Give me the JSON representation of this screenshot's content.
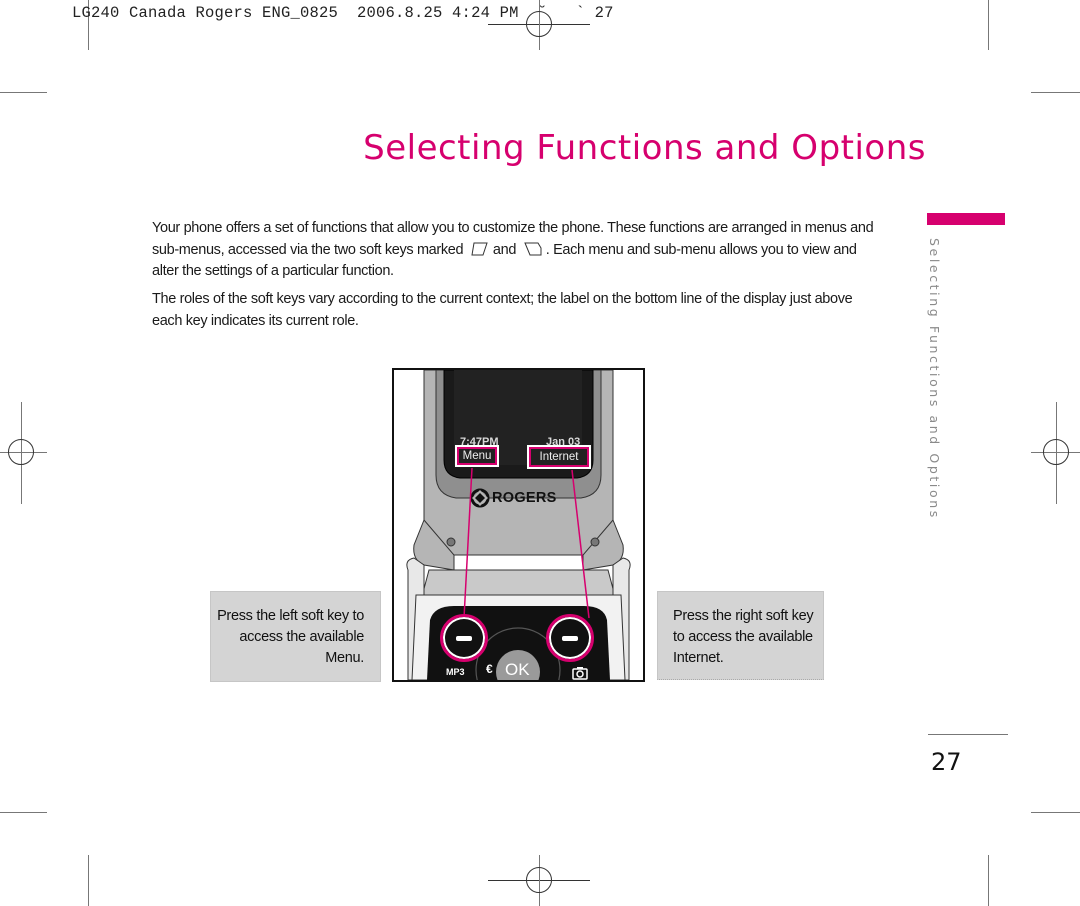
{
  "print_slug": {
    "text": "LG240 Canada Rogers ENG_0825  2006.8.25 4:24 PM  ˘   ` 27"
  },
  "page": {
    "title": "Selecting Functions and Options",
    "accent_color": "#d6006e",
    "section_tab_label": "Selecting Functions and Options",
    "page_number": "27"
  },
  "body": {
    "paragraph_1": {
      "before_keys": "Your phone offers a set of functions that allow you to customize the phone. These functions are arranged in menus and sub-menus, accessed via the two soft keys marked",
      "between_keys": "and",
      "after_keys": ". Each menu and sub-menu allows you to view and alter the settings of a particular function.",
      "left_key_icon": "left-softkey-icon",
      "right_key_icon": "right-softkey-icon"
    },
    "paragraph_2": "The roles of the soft keys vary according to the current context; the label on the bottom line of the display just above each key indicates its current role."
  },
  "figure": {
    "screen": {
      "time": "7:47PM",
      "date": "Jan 03",
      "left_softkey_label": "Menu",
      "right_softkey_label": "Internet"
    },
    "brand": "ROGERS",
    "keypad": {
      "ok_label": "OK",
      "mp3_label": "MP3",
      "euro_glyph": "€"
    },
    "callout_left": "Press the left soft key to access the available Menu.",
    "callout_right": "Press the right soft key to access the available Internet."
  }
}
